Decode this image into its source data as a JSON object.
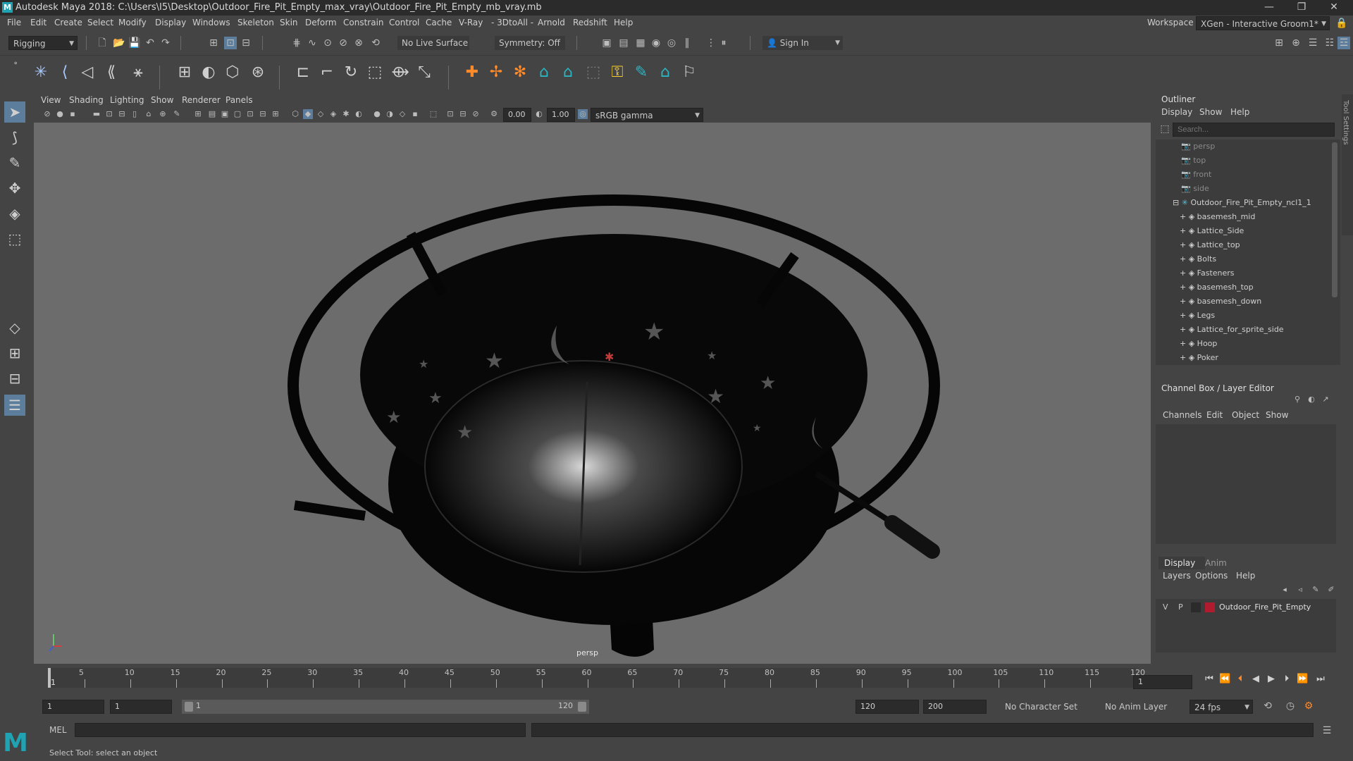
{
  "window": {
    "title": "Autodesk Maya 2018: C:\\Users\\I5\\Desktop\\Outdoor_Fire_Pit_Empty_max_vray\\Outdoor_Fire_Pit_Empty_mb_vray.mb"
  },
  "menubar": [
    "File",
    "Edit",
    "Create",
    "Select",
    "Modify",
    "Display",
    "Windows",
    "Skeleton",
    "Skin",
    "Deform",
    "Constrain",
    "Control",
    "Cache",
    "V-Ray",
    "- 3DtoAll -",
    "Arnold",
    "Redshift",
    "Help"
  ],
  "workspace": {
    "label": "Workspace :",
    "value": "XGen - Interactive Groom1*"
  },
  "statusline": {
    "menuset": "Rigging",
    "live_surface": "No Live Surface",
    "symmetry": "Symmetry: Off",
    "sign_in": "Sign In"
  },
  "viewport": {
    "menus": [
      "View",
      "Shading",
      "Lighting",
      "Show",
      "Renderer",
      "Panels"
    ],
    "exposure": "0.00",
    "gamma": "1.00",
    "color_space": "sRGB gamma",
    "camera_label": "persp"
  },
  "outliner": {
    "title": "Outliner",
    "menus": [
      "Display",
      "Show",
      "Help"
    ],
    "search_placeholder": "Search...",
    "cameras": [
      "persp",
      "top",
      "front",
      "side"
    ],
    "group": "Outdoor_Fire_Pit_Empty_ncl1_1",
    "children": [
      "basemesh_mid",
      "Lattice_Side",
      "Lattice_top",
      "Bolts",
      "Fasteners",
      "basemesh_top",
      "basemesh_down",
      "Legs",
      "Lattice_for_sprite_side",
      "Hoop",
      "Poker"
    ]
  },
  "channelbox": {
    "title": "Channel Box / Layer Editor",
    "menus": [
      "Channels",
      "Edit",
      "Object",
      "Show"
    ]
  },
  "layers": {
    "tabs": [
      "Display",
      "Anim"
    ],
    "menus": [
      "Layers",
      "Options",
      "Help"
    ],
    "layer": {
      "v": "V",
      "p": "P",
      "name": "Outdoor_Fire_Pit_Empty",
      "color": "#b01c2e"
    }
  },
  "timeline": {
    "ticks": [
      "5",
      "10",
      "15",
      "20",
      "25",
      "30",
      "35",
      "40",
      "45",
      "50",
      "55",
      "60",
      "65",
      "70",
      "75",
      "80",
      "85",
      "90",
      "95",
      "100",
      "105",
      "110",
      "115",
      "120"
    ],
    "start_label": "1",
    "current_frame": "1"
  },
  "range": {
    "start": "1",
    "playback_start": "1",
    "slider_start": "1",
    "slider_end": "120",
    "playback_end": "120",
    "end": "200",
    "character_set": "No Character Set",
    "anim_layer": "No Anim Layer",
    "fps": "24 fps"
  },
  "cmdline": {
    "label": "MEL"
  },
  "helpline": {
    "text": "Select Tool: select an object"
  },
  "tool_settings_tab": "Tool Settings",
  "colors": {
    "accent": "#1fa3b3",
    "bg": "#444444",
    "viewport": "#6c6c6c"
  }
}
